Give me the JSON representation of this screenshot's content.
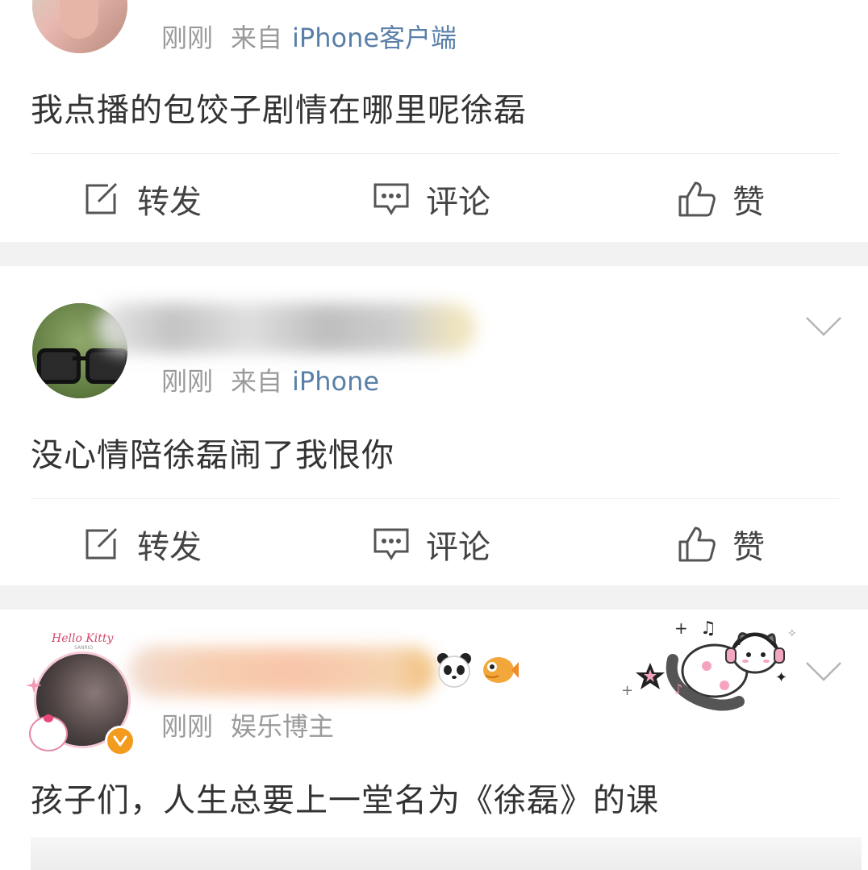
{
  "posts": [
    {
      "time": "刚刚",
      "source_prefix": "来自",
      "source": "iPhone客户端",
      "content": "我点播的包饺子剧情在哪里呢徐磊",
      "actions": {
        "repost": "转发",
        "comment": "评论",
        "like": "赞"
      }
    },
    {
      "time": "刚刚",
      "source_prefix": "来自",
      "source": "iPhone",
      "content": "没心情陪徐磊闹了我恨你",
      "actions": {
        "repost": "转发",
        "comment": "评论",
        "like": "赞"
      }
    },
    {
      "time": "刚刚",
      "label": "娱乐博主",
      "avatar_frame_text": "Hello Kitty",
      "content": "孩子们，人生总要上一堂名为《徐磊》的课"
    }
  ],
  "icons": [
    "edit-icon",
    "comment-icon",
    "thumbs-up-icon",
    "chevron-down-icon",
    "verified-v-icon",
    "panda-icon",
    "fish-icon"
  ],
  "colors": {
    "source_blue": "#5a7fa8",
    "meta_gray": "#9a9a9a",
    "verified_orange": "#f29b1d",
    "gap_gray": "#f2f2f2"
  }
}
